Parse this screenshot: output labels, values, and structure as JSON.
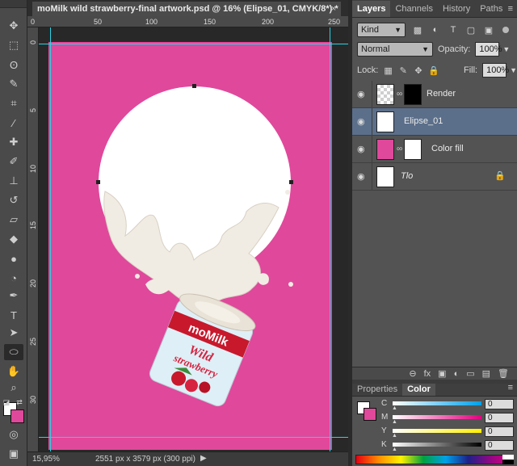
{
  "document": {
    "tab_title": "moMilk wild strawberry-final artwork.psd @ 16% (Elipse_01, CMYK/8*) *",
    "close_glyph": "×",
    "ruler_top_labels": [
      "0",
      "50",
      "100",
      "150",
      "200",
      "250"
    ],
    "ruler_left_labels": [
      "0",
      "5",
      "10",
      "15",
      "20",
      "25",
      "30"
    ],
    "status_zoom": "15,95%",
    "status_info": "2551 px x 3579 px (300 ppi)",
    "status_arrow": "▶",
    "artwork": {
      "brand": "moMilk",
      "product_line1": "Wild",
      "product_line2": "strawberry",
      "background_color": "#e0489b"
    }
  },
  "tools": [
    {
      "name": "move-tool-icon",
      "glyph": "✥"
    },
    {
      "name": "marquee-tool-icon",
      "glyph": "⬚"
    },
    {
      "name": "lasso-tool-icon",
      "glyph": "ʘ"
    },
    {
      "name": "quick-select-tool-icon",
      "glyph": "✎"
    },
    {
      "name": "crop-tool-icon",
      "glyph": "⌗"
    },
    {
      "name": "eyedropper-tool-icon",
      "glyph": "⁄"
    },
    {
      "name": "healing-brush-tool-icon",
      "glyph": "✚"
    },
    {
      "name": "brush-tool-icon",
      "glyph": "✐"
    },
    {
      "name": "clone-stamp-tool-icon",
      "glyph": "⊥"
    },
    {
      "name": "history-brush-tool-icon",
      "glyph": "↺"
    },
    {
      "name": "eraser-tool-icon",
      "glyph": "▱"
    },
    {
      "name": "paint-bucket-tool-icon",
      "glyph": "◆"
    },
    {
      "name": "blur-tool-icon",
      "glyph": "●"
    },
    {
      "name": "dodge-tool-icon",
      "glyph": "◔"
    },
    {
      "name": "pen-tool-icon",
      "glyph": "✒"
    },
    {
      "name": "type-tool-icon",
      "glyph": "T"
    },
    {
      "name": "path-selection-tool-icon",
      "glyph": "➤"
    },
    {
      "name": "ellipse-tool-icon",
      "glyph": "⬭"
    },
    {
      "name": "hand-tool-icon",
      "glyph": "✋"
    },
    {
      "name": "zoom-tool-icon",
      "glyph": "⌕"
    }
  ],
  "layers_panel": {
    "tabs": [
      "Layers",
      "Channels",
      "History",
      "Paths"
    ],
    "menu_glyph": "≡",
    "filter_kind": "Kind",
    "blend_mode": "Normal",
    "opacity_label": "Opacity:",
    "opacity_value": "100%",
    "lock_label": "Lock:",
    "fill_label": "Fill:",
    "fill_value": "100%",
    "layers": [
      {
        "name": "Render",
        "selected": false,
        "italic": false
      },
      {
        "name": "Elipse_01",
        "selected": true,
        "italic": false
      },
      {
        "name": "Color fill",
        "selected": false,
        "italic": false
      },
      {
        "name": "Tlo",
        "selected": false,
        "italic": true
      }
    ],
    "footer_icons": [
      "link-icon",
      "fx-icon",
      "mask-icon",
      "adjustment-icon",
      "group-icon",
      "new-layer-icon",
      "trash-icon"
    ],
    "footer_glyphs": [
      "⊖",
      "fx",
      "▣",
      "◐",
      "▭",
      "▤",
      "🗑"
    ]
  },
  "color_panel": {
    "tabs": [
      "Properties",
      "Color"
    ],
    "menu_glyph": "≡",
    "channels": [
      {
        "label": "C",
        "value": "0",
        "unit": "%",
        "gradient": "linear-gradient(to right,#ffffff,#00a0e9)"
      },
      {
        "label": "M",
        "value": "0",
        "unit": "%",
        "gradient": "linear-gradient(to right,#ffffff,#e4007f)"
      },
      {
        "label": "Y",
        "value": "0",
        "unit": "%",
        "gradient": "linear-gradient(to right,#ffffff,#fff100)"
      },
      {
        "label": "K",
        "value": "0",
        "unit": "%",
        "gradient": "linear-gradient(to right,#ffffff,#000000)"
      }
    ]
  }
}
